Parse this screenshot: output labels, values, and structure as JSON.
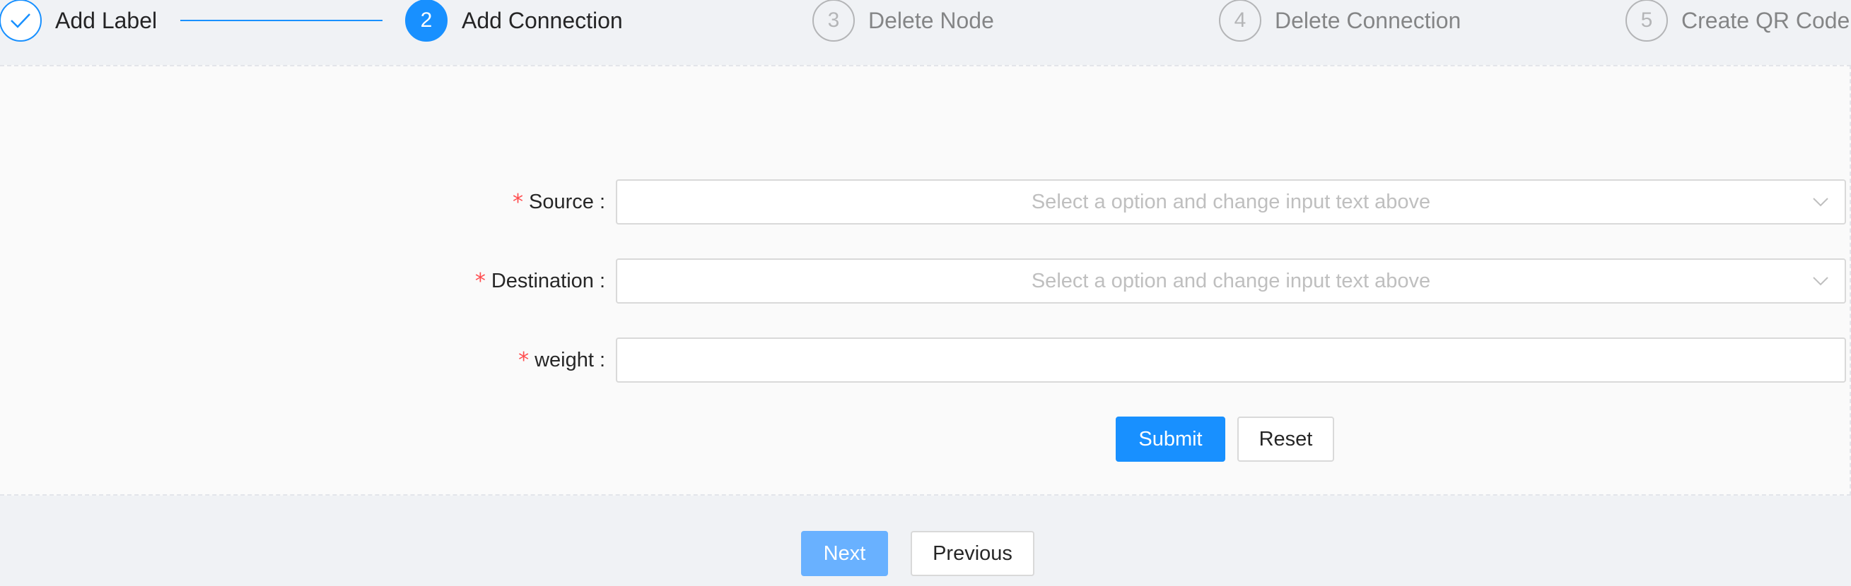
{
  "steps": [
    {
      "number": "",
      "title": "Add Label",
      "status": "finished"
    },
    {
      "number": "2",
      "title": "Add Connection",
      "status": "active"
    },
    {
      "number": "3",
      "title": "Delete Node",
      "status": "wait"
    },
    {
      "number": "4",
      "title": "Delete Connection",
      "status": "wait"
    },
    {
      "number": "5",
      "title": "Create QR Code",
      "status": "wait"
    }
  ],
  "form": {
    "required_mark": "*",
    "colon": ":",
    "source": {
      "label": "Source",
      "placeholder": "Select a option and change input text above"
    },
    "destination": {
      "label": "Destination",
      "placeholder": "Select a option and change input text above"
    },
    "weight": {
      "label": "weight",
      "value": ""
    },
    "submit_label": "Submit",
    "reset_label": "Reset"
  },
  "nav": {
    "next_label": "Next",
    "previous_label": "Previous"
  },
  "colors": {
    "primary": "#1890ff",
    "required": "#ff4d4f",
    "page_bg": "#f0f2f5",
    "panel_bg": "#fafafa"
  },
  "icons": {
    "finished_step": "check-icon",
    "select_arrow": "chevron-down-icon"
  }
}
